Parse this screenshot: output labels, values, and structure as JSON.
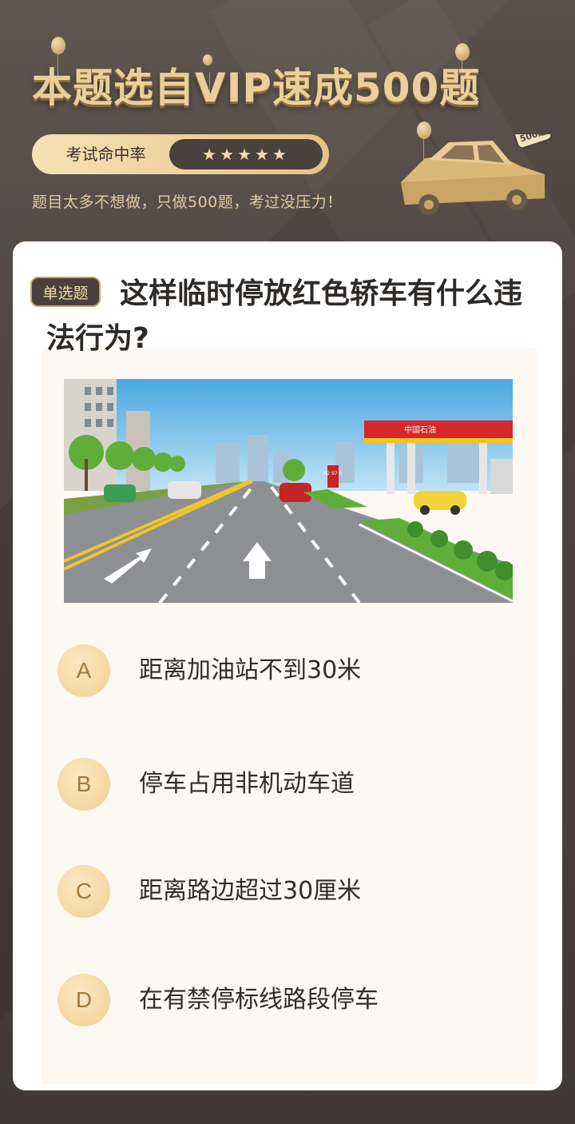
{
  "header": {
    "title": "本题选自VIP速成500题",
    "rating_label": "考试命中率",
    "stars": "★★★★★",
    "subtitle": "题目太多不想做，只做500题，考过没压力！",
    "car_badge": "500题"
  },
  "question": {
    "type_badge": "单选题",
    "text": "这样临时停放红色轿车有什么违法行为?",
    "scene": {
      "station_sign": "中国石油",
      "price_sign": "92 97 0"
    },
    "options": [
      {
        "letter": "A",
        "text": "距离加油站不到30米"
      },
      {
        "letter": "B",
        "text": "停车占用非机动车道"
      },
      {
        "letter": "C",
        "text": "距离路边超过30厘米"
      },
      {
        "letter": "D",
        "text": "在有禁停标线路段停车"
      }
    ]
  },
  "colors": {
    "background": "#4a403c",
    "gold": "#e9cf9a",
    "option_circle": "#f0cf92",
    "card": "#ffffff"
  }
}
